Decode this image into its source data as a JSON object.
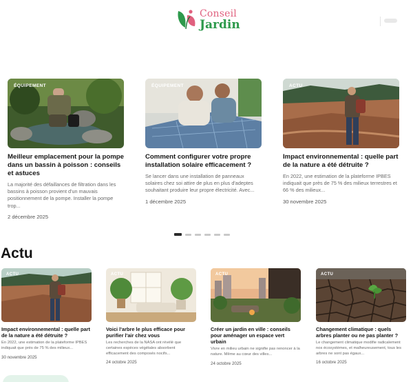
{
  "header": {
    "logo_line1": "Conseil",
    "logo_line2": "Jardin",
    "brand_pink": "#e0607e",
    "brand_green": "#2e9a4c",
    "menu_icon": "menu-icon"
  },
  "carousel": {
    "slides": [
      {
        "tag": "ÉQUIPEMENT",
        "title": "Meilleur emplacement pour la pompe dans un bassin à poisson : conseils et astuces",
        "excerpt": "La majorité des défaillances de filtration dans les bassins à poisson provient d'un mauvais positionnement de la pompe. Installer la pompe trop...",
        "date": "2 décembre 2025"
      },
      {
        "tag": "ÉQUIPEMENT",
        "title": "Comment configurer votre propre installation solaire efficacement ?",
        "excerpt": "Se lancer dans une installation de panneaux solaires chez soi attire de plus en plus d'adeptes souhaitant produire leur propre électricité. Avec...",
        "date": "1 décembre 2025"
      },
      {
        "tag": "ACTU",
        "title": "Impact environnemental : quelle part de la nature a été détruite ?",
        "excerpt": "En 2022, une estimation de la plateforme IPBES indiquait que près de 75 % des milieux terrestres et 66 % des milieux...",
        "date": "30 novembre 2025"
      }
    ],
    "active_dot": 1,
    "dot_count": 6
  },
  "actu": {
    "heading": "Actu",
    "cards": [
      {
        "tag": "ACTU",
        "title": "Impact environnemental : quelle part de la nature a été détruite ?",
        "excerpt": "En 2022, une estimation de la plateforme IPBES indiquait que près de 75 % des milieux...",
        "date": "30 novembre 2025"
      },
      {
        "tag": "ACTU",
        "title": "Voici l'arbre le plus efficace pour purifier l'air chez vous",
        "excerpt": "Les recherches de la NASA ont révélé que certaines espèces végétales absorbent efficacement des composés nocifs...",
        "date": "24 octobre 2025"
      },
      {
        "tag": "ACTU",
        "title": "Créer un jardin en ville : conseils pour aménager un espace vert urbain",
        "excerpt": "Vivre en milieu urbain ne signifie pas renoncer à la nature. Même au cœur des villes...",
        "date": "24 octobre 2025"
      },
      {
        "tag": "ACTU",
        "title": "Changement climatique : quels arbres planter ou ne pas planter ?",
        "excerpt": "Le changement climatique modifie radicalement nos écosystèmes, et malheureusement, tous les arbres ne sont pas égaux...",
        "date": "16 octobre 2025"
      }
    ]
  }
}
